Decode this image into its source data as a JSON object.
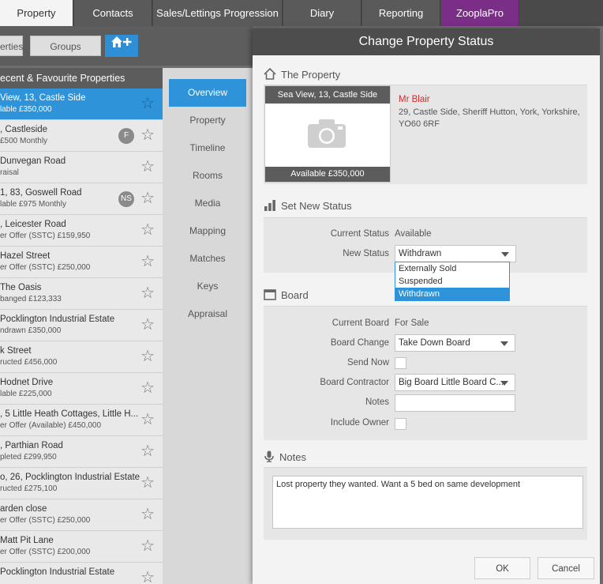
{
  "top_tabs": [
    {
      "label": "Property",
      "active": true
    },
    {
      "label": "Contacts"
    },
    {
      "label": "Sales/Lettings Progression"
    },
    {
      "label": "Diary"
    },
    {
      "label": "Reporting"
    },
    {
      "label": "ZooplaPro"
    }
  ],
  "sub_buttons": {
    "properties": "erties",
    "groups": "Groups"
  },
  "list": {
    "heading": "ecent & Favourite Properties",
    "items": [
      {
        "line1": "View, 13, Castle Side",
        "line2": "lable £350,000",
        "selected": true
      },
      {
        "line1": ", Castleside",
        "line2": "£500 Monthly",
        "badge": "F"
      },
      {
        "line1": "Dunvegan Road",
        "line2": "raisal"
      },
      {
        "line1": " 1, 83, Goswell Road",
        "line2": "lable £975 Monthly",
        "badge": "NS"
      },
      {
        "line1": ", Leicester Road",
        "line2": "er Offer (SSTC) £159,950"
      },
      {
        "line1": "Hazel Street",
        "line2": "er Offer (SSTC) £250,000"
      },
      {
        "line1": "The Oasis",
        "line2": "banged £123,333"
      },
      {
        "line1": "Pocklington Industrial Estate",
        "line2": "ndrawn £350,000"
      },
      {
        "line1": "k Street",
        "line2": "ructed £456,000"
      },
      {
        "line1": "Hodnet Drive",
        "line2": "lable £225,000"
      },
      {
        "line1": ", 5 Little Heath Cottages, Little H...",
        "line2": "er Offer (Available) £450,000"
      },
      {
        "line1": ", Parthian Road",
        "line2": "pleted £299,950"
      },
      {
        "line1": "o, 26, Pocklington Industrial Estate",
        "line2": "ructed £275,100"
      },
      {
        "line1": "arden close",
        "line2": "er Offer (SSTC) £250,000"
      },
      {
        "line1": "Matt Pit Lane",
        "line2": "er Offer (SSTC) £200,000"
      },
      {
        "line1": "Pocklington Industrial Estate",
        "line2": ""
      }
    ]
  },
  "nav": [
    "Overview",
    "Property",
    "Timeline",
    "Rooms",
    "Media",
    "Mapping",
    "Matches",
    "Keys",
    "Appraisal"
  ],
  "modal": {
    "title": "Change Property Status",
    "property_section": "The Property",
    "property_card_title": "Sea View, 13, Castle Side",
    "property_card_footer": "Available £350,000",
    "owner": "Mr Blair",
    "address": "29, Castle Side, Sheriff Hutton, York, Yorkshire, YO60 6RF",
    "status_section": "Set New Status",
    "current_status_label": "Current Status",
    "current_status_value": "Available",
    "new_status_label": "New Status",
    "new_status_value": "Withdrawn",
    "status_options": [
      "Externally Sold",
      "Suspended",
      "Withdrawn"
    ],
    "board_section": "Board",
    "current_board_label": "Current Board",
    "current_board_value": "For Sale",
    "board_change_label": "Board Change",
    "board_change_value": "Take Down Board",
    "send_now_label": "Send Now",
    "board_contractor_label": "Board Contractor",
    "board_contractor_value": "Big Board Little Board C...",
    "notes_field_label": "Notes",
    "include_owner_label": "Include Owner",
    "notes_section": "Notes",
    "notes_text": "Lost property they wanted. Want a 5 bed on same development",
    "ok_label": "OK",
    "cancel_label": "Cancel"
  },
  "colors": {
    "accent": "#2e93d8",
    "zoopla": "#7b2e87",
    "owner_red": "#d32a2a"
  }
}
